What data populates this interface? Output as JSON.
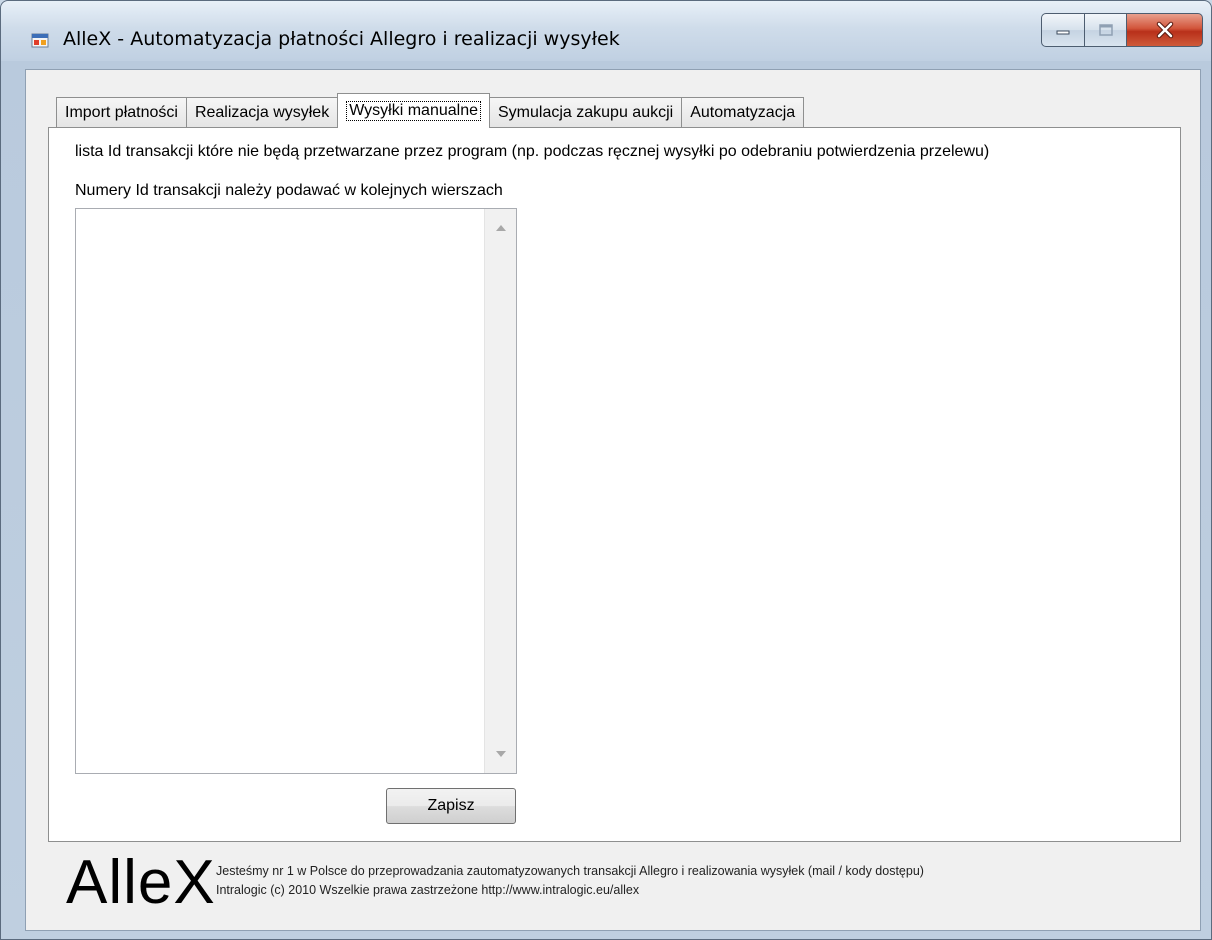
{
  "window": {
    "title": "AlleX - Automatyzacja płatności Allegro i realizacji wysyłek"
  },
  "tabs": [
    {
      "label": "Import płatności"
    },
    {
      "label": "Realizacja wysyłek"
    },
    {
      "label": "Wysyłki manualne",
      "selected": true
    },
    {
      "label": "Symulacja zakupu aukcji"
    },
    {
      "label": "Automatyzacja"
    }
  ],
  "main": {
    "description": "lista Id transakcji które nie będą przetwarzane przez program (np. podczas ręcznej wysyłki po odebraniu potwierdzenia przelewu)",
    "instruction": "Numery Id transakcji należy podawać w kolejnych wierszach",
    "transaction_ids_value": "",
    "save_label": "Zapisz"
  },
  "footer": {
    "logo": "AlleX",
    "line1": "Jesteśmy nr 1 w Polsce do przeprowadzania zautomatyzowanych transakcji Allegro i realizowania wysyłek (mail / kody dostępu)",
    "line2": "Intralogic (c) 2010 Wszelkie prawa zastrzeżone   http://www.intralogic.eu/allex"
  },
  "icons": {
    "app": "app-window-icon",
    "minimize": "minimize-icon",
    "maximize": "maximize-icon",
    "close": "close-icon",
    "scroll_up": "scroll-up-arrow-icon",
    "scroll_down": "scroll-down-arrow-icon"
  },
  "colors": {
    "close_button": "#c9432a",
    "tab_page_background": "#ffffff",
    "dialog_background": "#f0f0f0"
  }
}
